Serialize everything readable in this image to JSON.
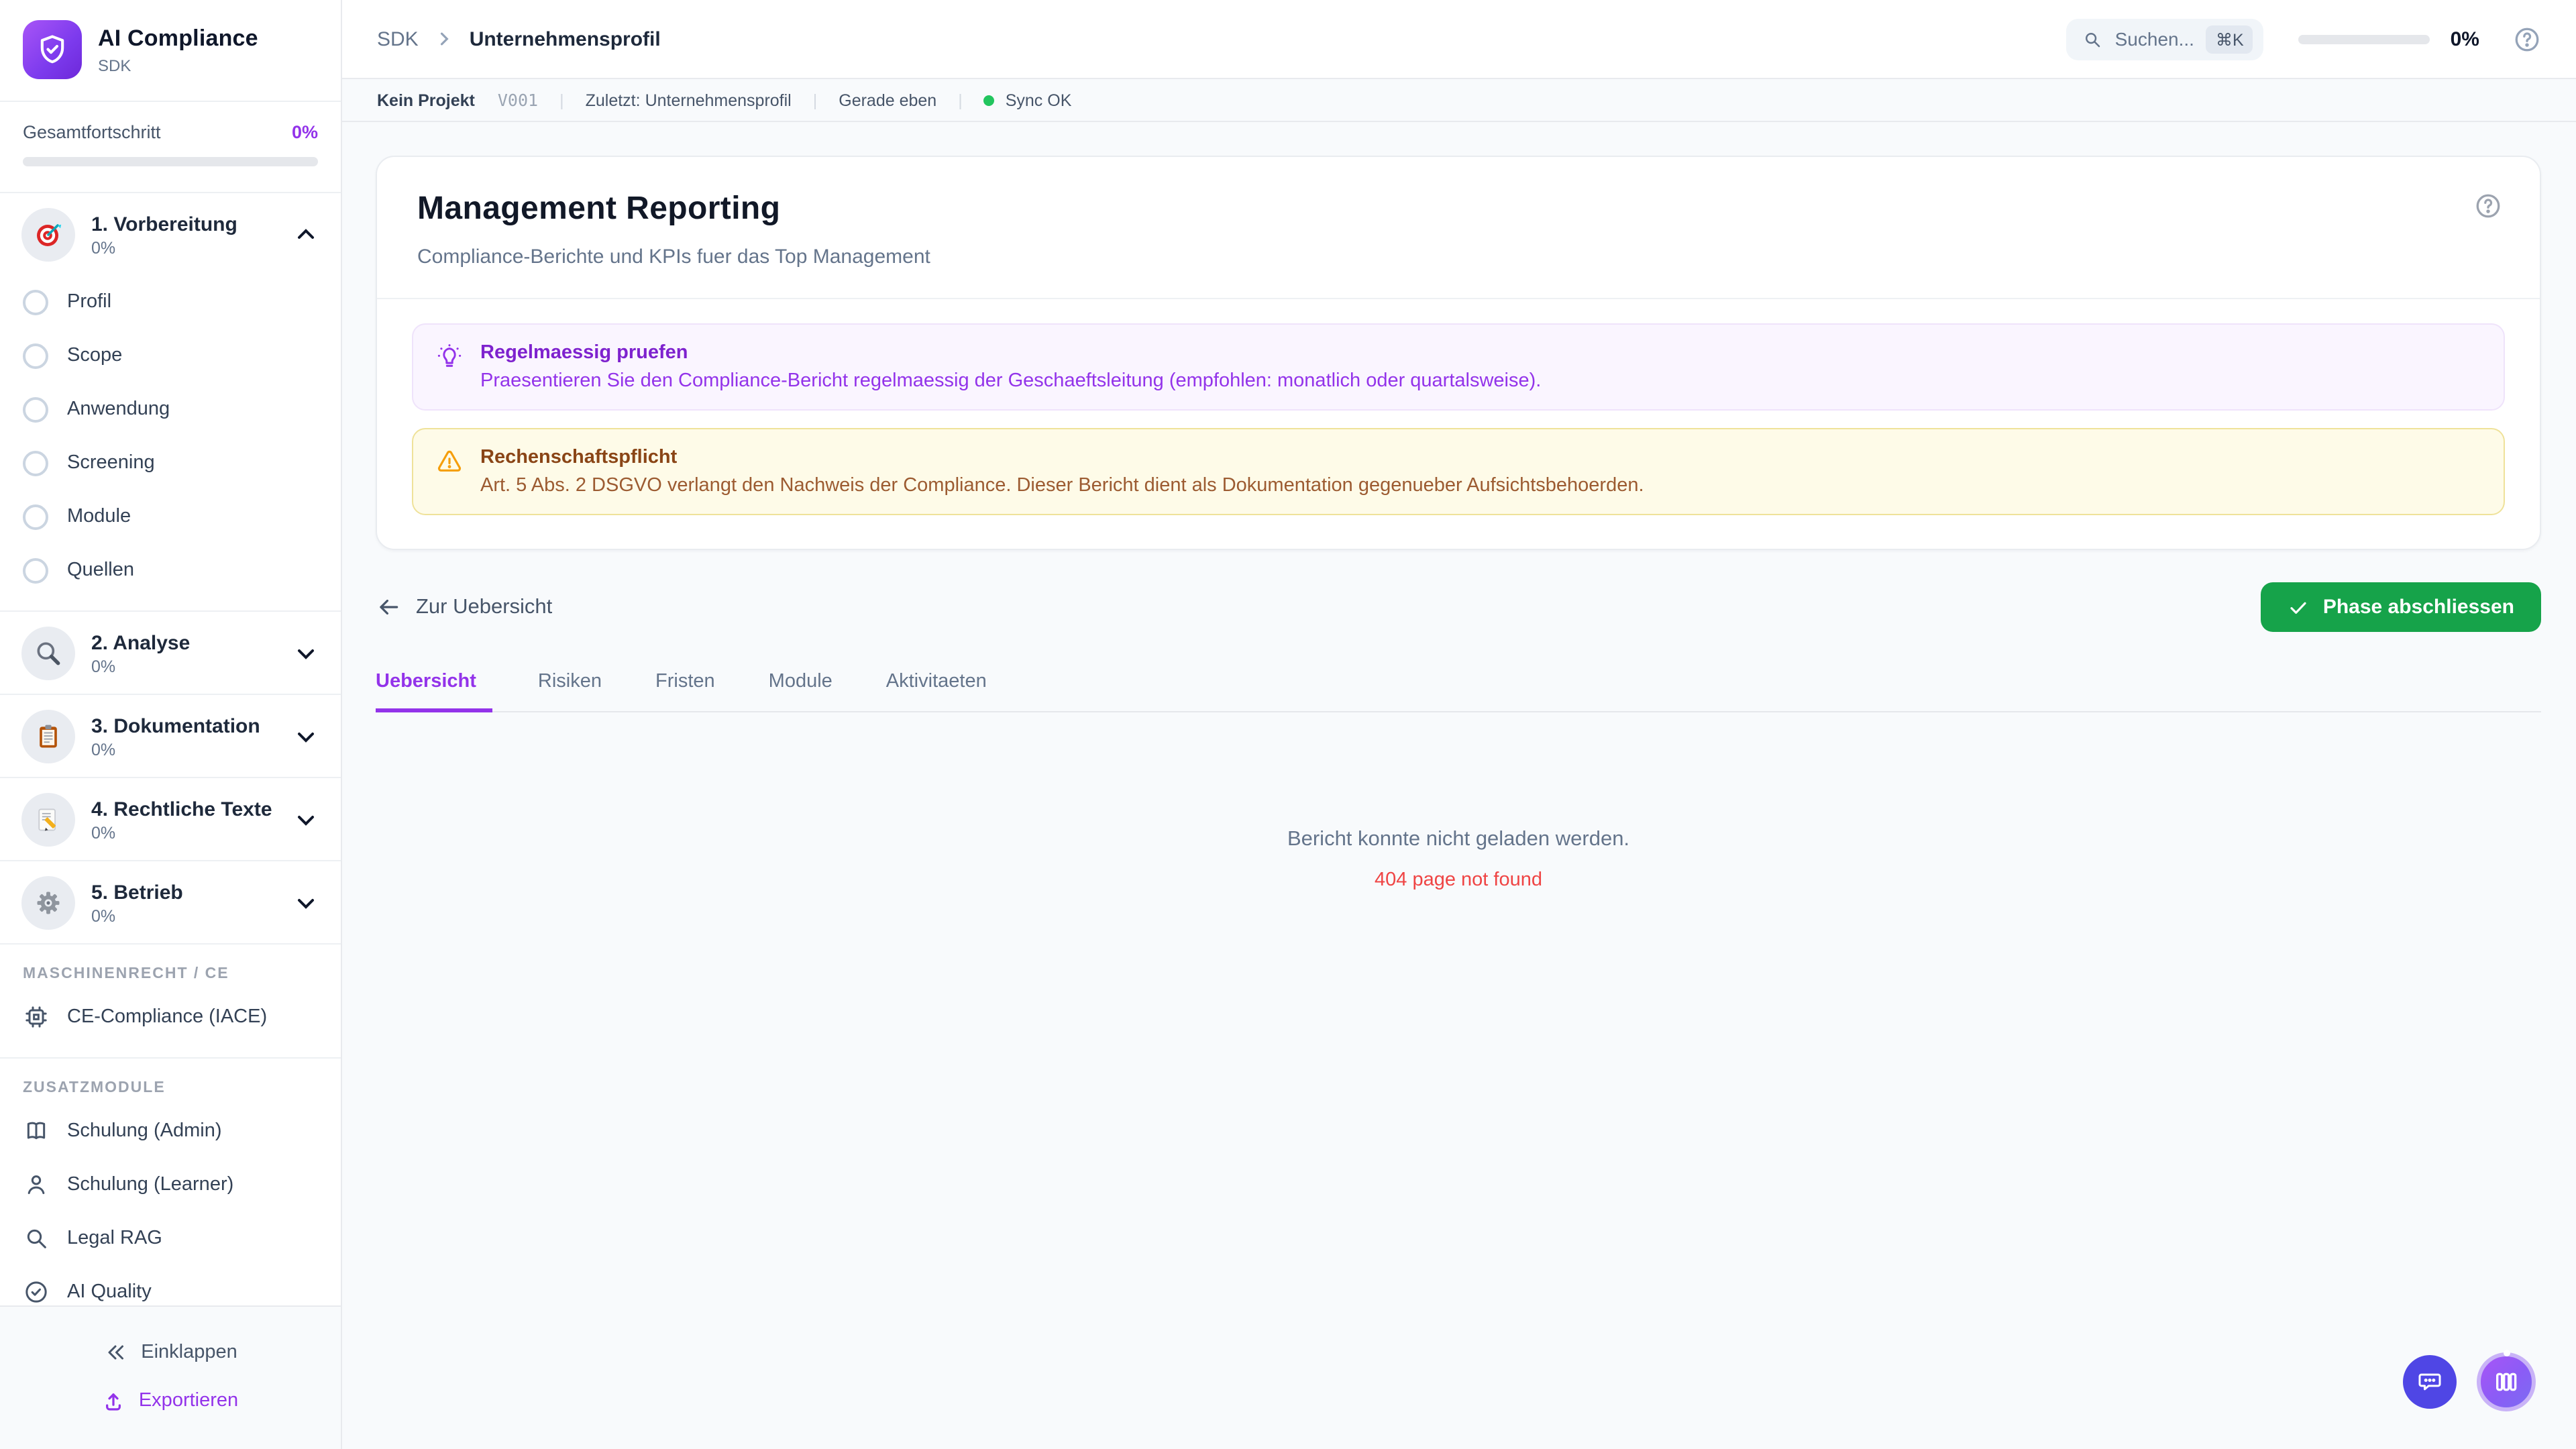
{
  "app": {
    "title": "AI Compliance",
    "subtitle": "SDK"
  },
  "sidebar": {
    "progress": {
      "label": "Gesamtfortschritt",
      "value": "0%"
    },
    "phases": [
      {
        "icon": "target-icon",
        "label": "1. Vorbereitung",
        "percent": "0%",
        "expanded": true,
        "items": [
          "Profil",
          "Scope",
          "Anwendung",
          "Screening",
          "Module",
          "Quellen"
        ]
      },
      {
        "icon": "magnifier-icon",
        "label": "2. Analyse",
        "percent": "0%",
        "expanded": false
      },
      {
        "icon": "clipboard-icon",
        "label": "3. Dokumentation",
        "percent": "0%",
        "expanded": false
      },
      {
        "icon": "memo-pencil-icon",
        "label": "4. Rechtliche Texte",
        "percent": "0%",
        "expanded": false
      },
      {
        "icon": "gear-icon",
        "label": "5. Betrieb",
        "percent": "0%",
        "expanded": false
      }
    ],
    "machine_section": {
      "header": "MASCHINENRECHT / CE",
      "items": [
        {
          "icon": "chip-icon",
          "label": "CE-Compliance (IACE)"
        }
      ]
    },
    "addons_section": {
      "header": "ZUSATZMODULE",
      "items": [
        {
          "icon": "book-icon",
          "label": "Schulung (Admin)"
        },
        {
          "icon": "user-icon",
          "label": "Schulung (Learner)"
        },
        {
          "icon": "search-icon",
          "label": "Legal RAG"
        },
        {
          "icon": "check-circle-icon",
          "label": "AI Quality"
        }
      ]
    },
    "footer": {
      "collapse": "Einklappen",
      "export": "Exportieren"
    }
  },
  "topbar": {
    "breadcrumb_root": "SDK",
    "breadcrumb_current": "Unternehmensprofil",
    "search_label": "Suchen...",
    "search_shortcut": "⌘K",
    "progress_value": "0%"
  },
  "statusbar": {
    "project": "Kein Projekt",
    "version": "V001",
    "last_label": "Zuletzt:",
    "last_value": "Unternehmensprofil",
    "updated": "Gerade eben",
    "sync_label": "Sync OK"
  },
  "page": {
    "title": "Management Reporting",
    "subtitle": "Compliance-Berichte und KPIs fuer das Top Management"
  },
  "notices": [
    {
      "type": "tip",
      "icon": "lightbulb-icon",
      "title": "Regelmaessig pruefen",
      "text": "Praesentieren Sie den Compliance-Bericht regelmaessig der Geschaeftsleitung (empfohlen: monatlich oder quartalsweise)."
    },
    {
      "type": "warning",
      "icon": "warning-triangle-icon",
      "title": "Rechenschaftspflicht",
      "text": "Art. 5 Abs. 2 DSGVO verlangt den Nachweis der Compliance. Dieser Bericht dient als Dokumentation gegenueber Aufsichtsbehoerden."
    }
  ],
  "actions": {
    "back": "Zur Uebersicht",
    "complete": "Phase abschliessen"
  },
  "tabs": [
    {
      "label": "Uebersicht",
      "active": true
    },
    {
      "label": "Risiken",
      "active": false
    },
    {
      "label": "Fristen",
      "active": false
    },
    {
      "label": "Module",
      "active": false
    },
    {
      "label": "Aktivitaeten",
      "active": false
    }
  ],
  "empty_state": {
    "message": "Bericht konnte nicht geladen werden.",
    "error": "404 page not found"
  },
  "colors": {
    "accent": "#9333ea",
    "success": "#16a34a",
    "error": "#ef4444",
    "sync_ok": "#22c55e",
    "chat_fab": "#4f46e5",
    "warning": "#f59e0b"
  }
}
